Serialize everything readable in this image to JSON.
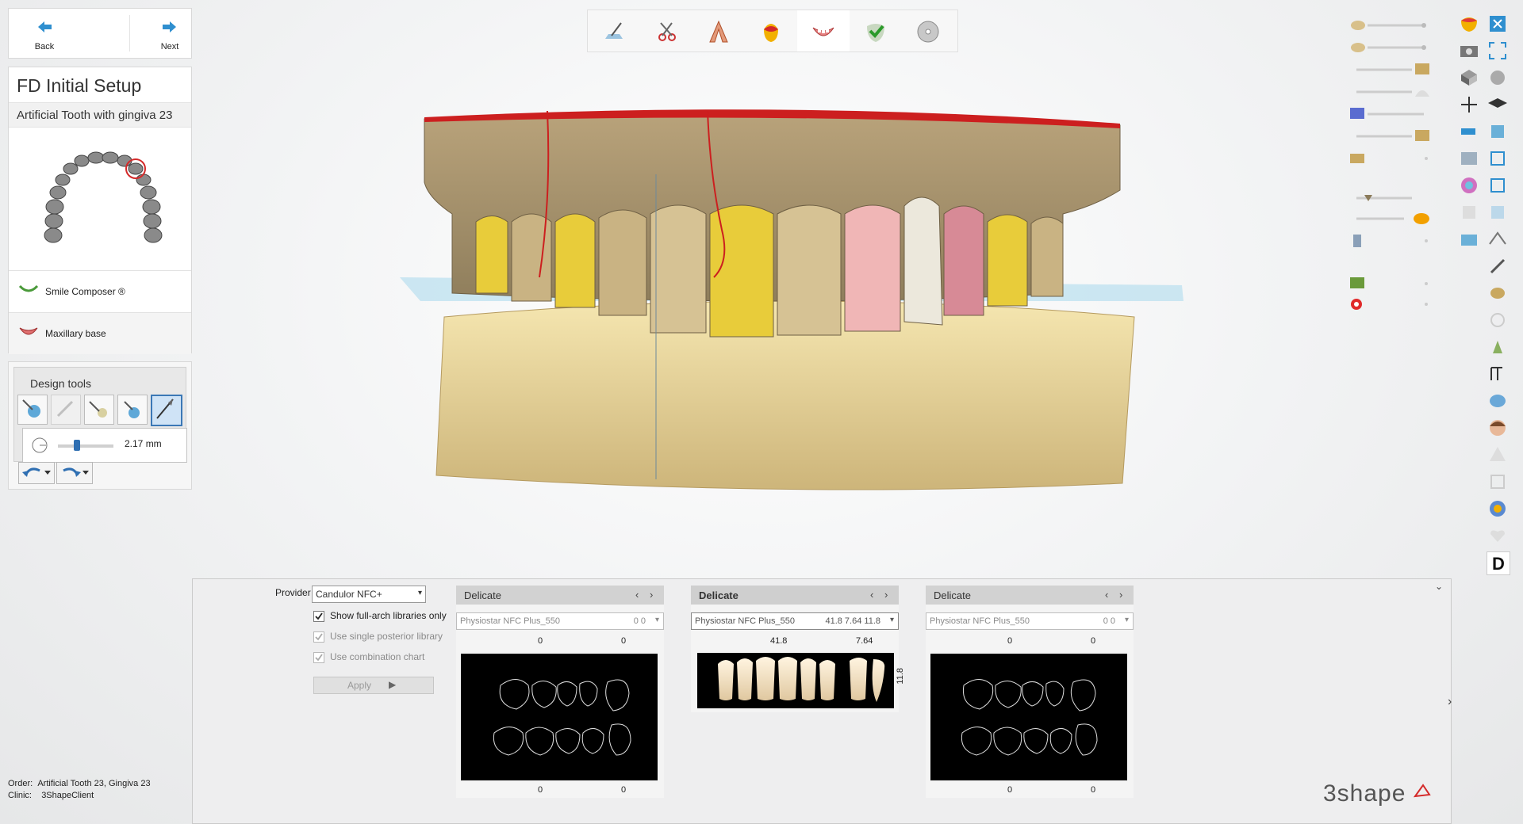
{
  "nav": {
    "back_label": "Back",
    "next_label": "Next"
  },
  "setup": {
    "title": "FD Initial Setup",
    "subtitle": "Artificial Tooth with gingiva 23",
    "steps": [
      {
        "label": "Smile Composer ®",
        "icon": "smile-composer-icon"
      },
      {
        "label": "Maxillary base",
        "icon": "maxillary-base-icon"
      }
    ]
  },
  "design_tools": {
    "title": "Design tools",
    "tools": [
      "add-material-icon",
      "remove-material-icon",
      "smooth-icon",
      "morph-icon",
      "knife-icon"
    ],
    "active_tool": 4,
    "slider_value": "2.17 mm"
  },
  "workflow_steps": [
    "scan-icon",
    "trim-icon",
    "arch-icon",
    "gingiva-color-icon",
    "teeth-setup-icon",
    "verify-icon",
    "save-disc-icon"
  ],
  "workflow_current": 4,
  "library": {
    "provider_label": "Provider",
    "provider_value": "Candulor NFC+",
    "options": [
      {
        "label": "Show full-arch libraries only",
        "checked": true,
        "enabled": true
      },
      {
        "label": "Use single posterior library",
        "checked": true,
        "enabled": false
      },
      {
        "label": "Use combination chart",
        "checked": true,
        "enabled": false
      }
    ],
    "apply_label": "Apply",
    "panels": [
      {
        "title": "Delicate",
        "library": "Physiostar NFC Plus_550",
        "values": "0  0",
        "top_left": "0",
        "top_right": "0",
        "bottom_left": "0",
        "bottom_right": "0",
        "active": false
      },
      {
        "title": "Delicate",
        "library": "Physiostar NFC Plus_550",
        "values": "41.8  7.64  11.8",
        "top_left": "41.8",
        "top_right": "7.64",
        "side": "11.8",
        "active": true
      },
      {
        "title": "Delicate",
        "library": "Physiostar NFC Plus_550",
        "values": "0  0",
        "top_left": "0",
        "top_right": "0",
        "bottom_left": "0",
        "bottom_right": "0",
        "active": false
      }
    ]
  },
  "order": {
    "order_label": "Order:",
    "order_value": "Artificial Tooth 23, Gingiva 23",
    "clinic_label": "Clinic:",
    "clinic_value": "3ShapeClient"
  },
  "brand": "3shape",
  "right_rail_icons": [
    "tooth-color-icon",
    "camera-icon",
    "box-icon",
    "grid-icon",
    "screen-icon",
    "drawers-icon",
    "color-wheel-icon",
    "a2-shade-icon",
    "scan-body-icon",
    "close-view-icon",
    "fullscreen-icon",
    "gear-globe-icon",
    "graduation-cap-icon",
    "panel-view-icon",
    "panel-copy-icon",
    "layer-icon",
    "layer-down-icon",
    "layer-move-icon",
    "brush-icon",
    "tooth-scan-icon",
    "tooth-outline-icon",
    "implant-icon",
    "bracket-icon",
    "shaper-icon",
    "face-icon",
    "warning-icon",
    "tooth-box-icon",
    "globe-icon",
    "heart-icon",
    "d-icon"
  ],
  "colors": {
    "accent": "#2f6fb2",
    "gingiva": "#e8d49a",
    "occlusion_red": "#cc1f1f",
    "occlusion_yellow": "#f2d400"
  }
}
